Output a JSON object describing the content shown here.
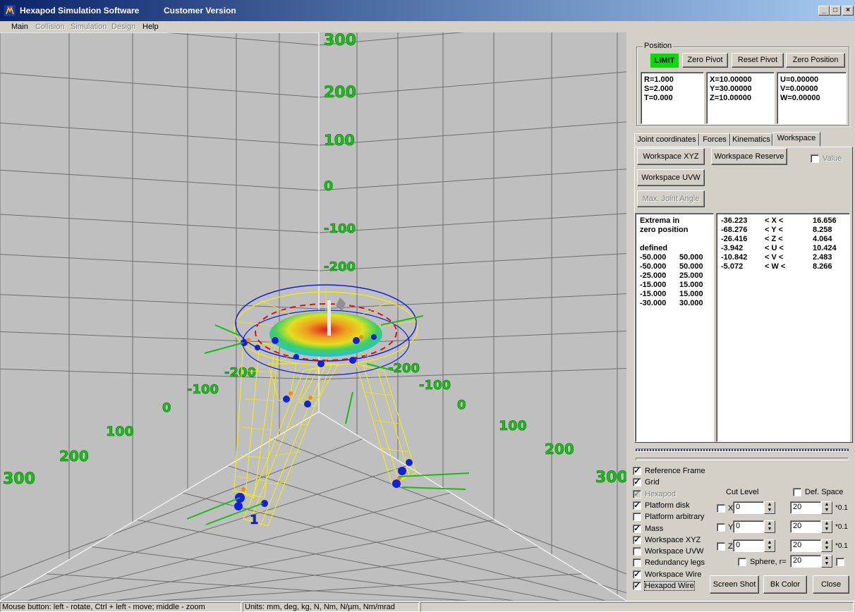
{
  "window": {
    "title": "Hexapod Simulation Software",
    "version": "Customer Version",
    "minimize": "_",
    "maximize": "□",
    "close": "×"
  },
  "menu": [
    {
      "label": "Main",
      "enabled": true
    },
    {
      "label": "Collision",
      "enabled": false
    },
    {
      "label": "Simulation",
      "enabled": false
    },
    {
      "label": "Design",
      "enabled": false
    },
    {
      "label": "Help",
      "enabled": true
    }
  ],
  "viewport": {
    "back_axis_labels": [
      "300",
      "200",
      "100",
      "0",
      "-100",
      "-200"
    ],
    "left_floor_labels": [
      "-200",
      "-100",
      "0",
      "100",
      "200",
      "300"
    ],
    "right_floor_labels": [
      "-200",
      "-100",
      "0",
      "100",
      "200",
      "300"
    ],
    "leg_label": "1",
    "colors": {
      "background": "#bfbfbf",
      "grid": "#6e6e6e",
      "axis_text": "#18c018",
      "wire": "#f5f000",
      "ring": "#1020e0",
      "vectors": "#12c012"
    }
  },
  "position": {
    "group_label": "Position",
    "limit_label": "LIMIT",
    "zero_pivot": "Zero Pivot",
    "reset_pivot": "Reset Pivot",
    "zero_position": "Zero Position",
    "rst": [
      "R=1.000",
      "S=2.000",
      "T=0.000"
    ],
    "xyz": [
      "X=10.00000",
      "Y=30.00000",
      "Z=10.00000"
    ],
    "uvw": [
      "U=0.00000",
      "V=0.00000",
      "W=0.00000"
    ]
  },
  "tabs": [
    {
      "label": "Joint coordinates",
      "active": false
    },
    {
      "label": "Forces",
      "active": false
    },
    {
      "label": "Kinematics",
      "active": false
    },
    {
      "label": "Workspace",
      "active": true
    }
  ],
  "workspace": {
    "xyz_button": "Workspace XYZ",
    "reserve_button": "Workspace Reserve",
    "value_label": "Value",
    "uvw_button": "Workspace UVW",
    "max_joint_button": "Max. Joint Angle",
    "extrema_title_1": "Extrema in",
    "extrema_title_2": "zero position",
    "defined_label": "defined",
    "defined": [
      [
        "-50.000",
        "50.000"
      ],
      [
        "-50.000",
        "50.000"
      ],
      [
        "-25.000",
        "25.000"
      ],
      [
        "-15.000",
        "15.000"
      ],
      [
        "-15.000",
        "15.000"
      ],
      [
        "-30.000",
        "30.000"
      ]
    ],
    "extrema": [
      [
        "-36.223",
        "< X <",
        "16.656"
      ],
      [
        "-68.276",
        "< Y <",
        "8.258"
      ],
      [
        "-26.416",
        "< Z <",
        "4.064"
      ],
      [
        "-3.942",
        "< U <",
        "10.424"
      ],
      [
        "-10.842",
        "< V <",
        "2.483"
      ],
      [
        "-5.072",
        "< W <",
        "8.266"
      ]
    ]
  },
  "display_options": [
    {
      "label": "Reference Frame",
      "checked": true,
      "enabled": true
    },
    {
      "label": "Grid",
      "checked": true,
      "enabled": true
    },
    {
      "label": "Hexapod",
      "checked": true,
      "enabled": false
    },
    {
      "label": "Platform disk",
      "checked": true,
      "enabled": true
    },
    {
      "label": "Platform arbitrary",
      "checked": false,
      "enabled": true
    },
    {
      "label": "Mass",
      "checked": true,
      "enabled": true
    },
    {
      "label": "Workspace XYZ",
      "checked": true,
      "enabled": true
    },
    {
      "label": "Workspace UVW",
      "checked": false,
      "enabled": true
    },
    {
      "label": "Redundancy legs",
      "checked": false,
      "enabled": true
    },
    {
      "label": "Workspace Wire",
      "checked": true,
      "enabled": true
    },
    {
      "label": "Hexapod Wire",
      "checked": true,
      "enabled": true
    }
  ],
  "cut": {
    "cut_level_label": "Cut Level",
    "def_space_label": "Def. Space",
    "rows": [
      {
        "axis": "X",
        "level": "0",
        "value": "20",
        "unit": "*0.1"
      },
      {
        "axis": "Y",
        "level": "0",
        "value": "20",
        "unit": "*0.1"
      },
      {
        "axis": "Z",
        "level": "0",
        "value": "20",
        "unit": "*0.1"
      }
    ],
    "sphere_label": "Sphere, r=",
    "sphere_value": "20"
  },
  "buttons": {
    "screen_shot": "Screen Shot",
    "bk_color": "Bk Color",
    "close": "Close"
  },
  "status": {
    "mouse_help": "Mouse button: left - rotate, Ctrl + left - move;  middle - zoom",
    "units": "Units:  mm, deg, kg, N, Nm, N/µm, Nm/mrad"
  }
}
